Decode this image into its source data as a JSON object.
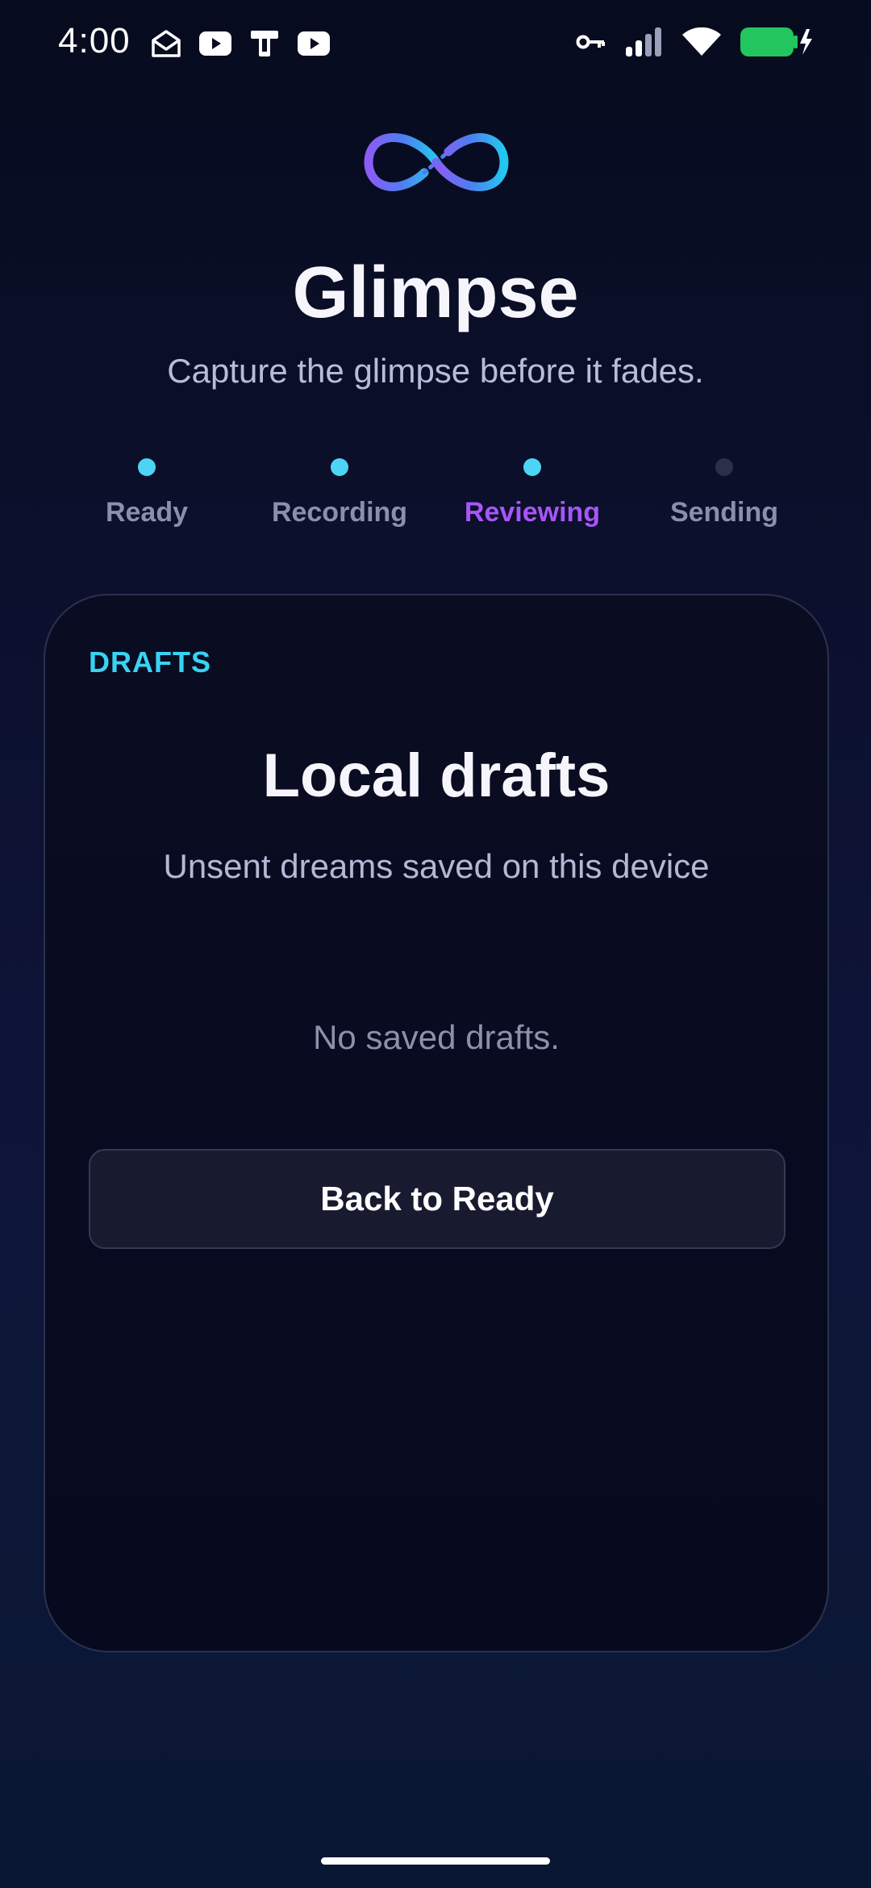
{
  "status_bar": {
    "time": "4:00",
    "left_icons": [
      "mail-open-icon",
      "youtube-icon",
      "phone-device-icon",
      "youtube-icon"
    ],
    "right_icons": [
      "vpn-key-icon",
      "cell-signal-icon",
      "wifi-icon",
      "battery-charging-icon"
    ],
    "battery_color": "#22c55e"
  },
  "header": {
    "logo_icon": "infinity-icon",
    "title": "Glimpse",
    "tagline": "Capture the glimpse before it fades."
  },
  "steps": [
    {
      "label": "Ready",
      "state": "done"
    },
    {
      "label": "Recording",
      "state": "done"
    },
    {
      "label": "Reviewing",
      "state": "active"
    },
    {
      "label": "Sending",
      "state": "pending"
    }
  ],
  "card": {
    "kicker": "DRAFTS",
    "title": "Local drafts",
    "subtitle": "Unsent dreams saved on this device",
    "empty_text": "No saved drafts.",
    "back_button_label": "Back to Ready"
  },
  "colors": {
    "accent_cyan": "#38d3f2",
    "accent_purple": "#a855f7",
    "background": "#0b0f2a"
  }
}
